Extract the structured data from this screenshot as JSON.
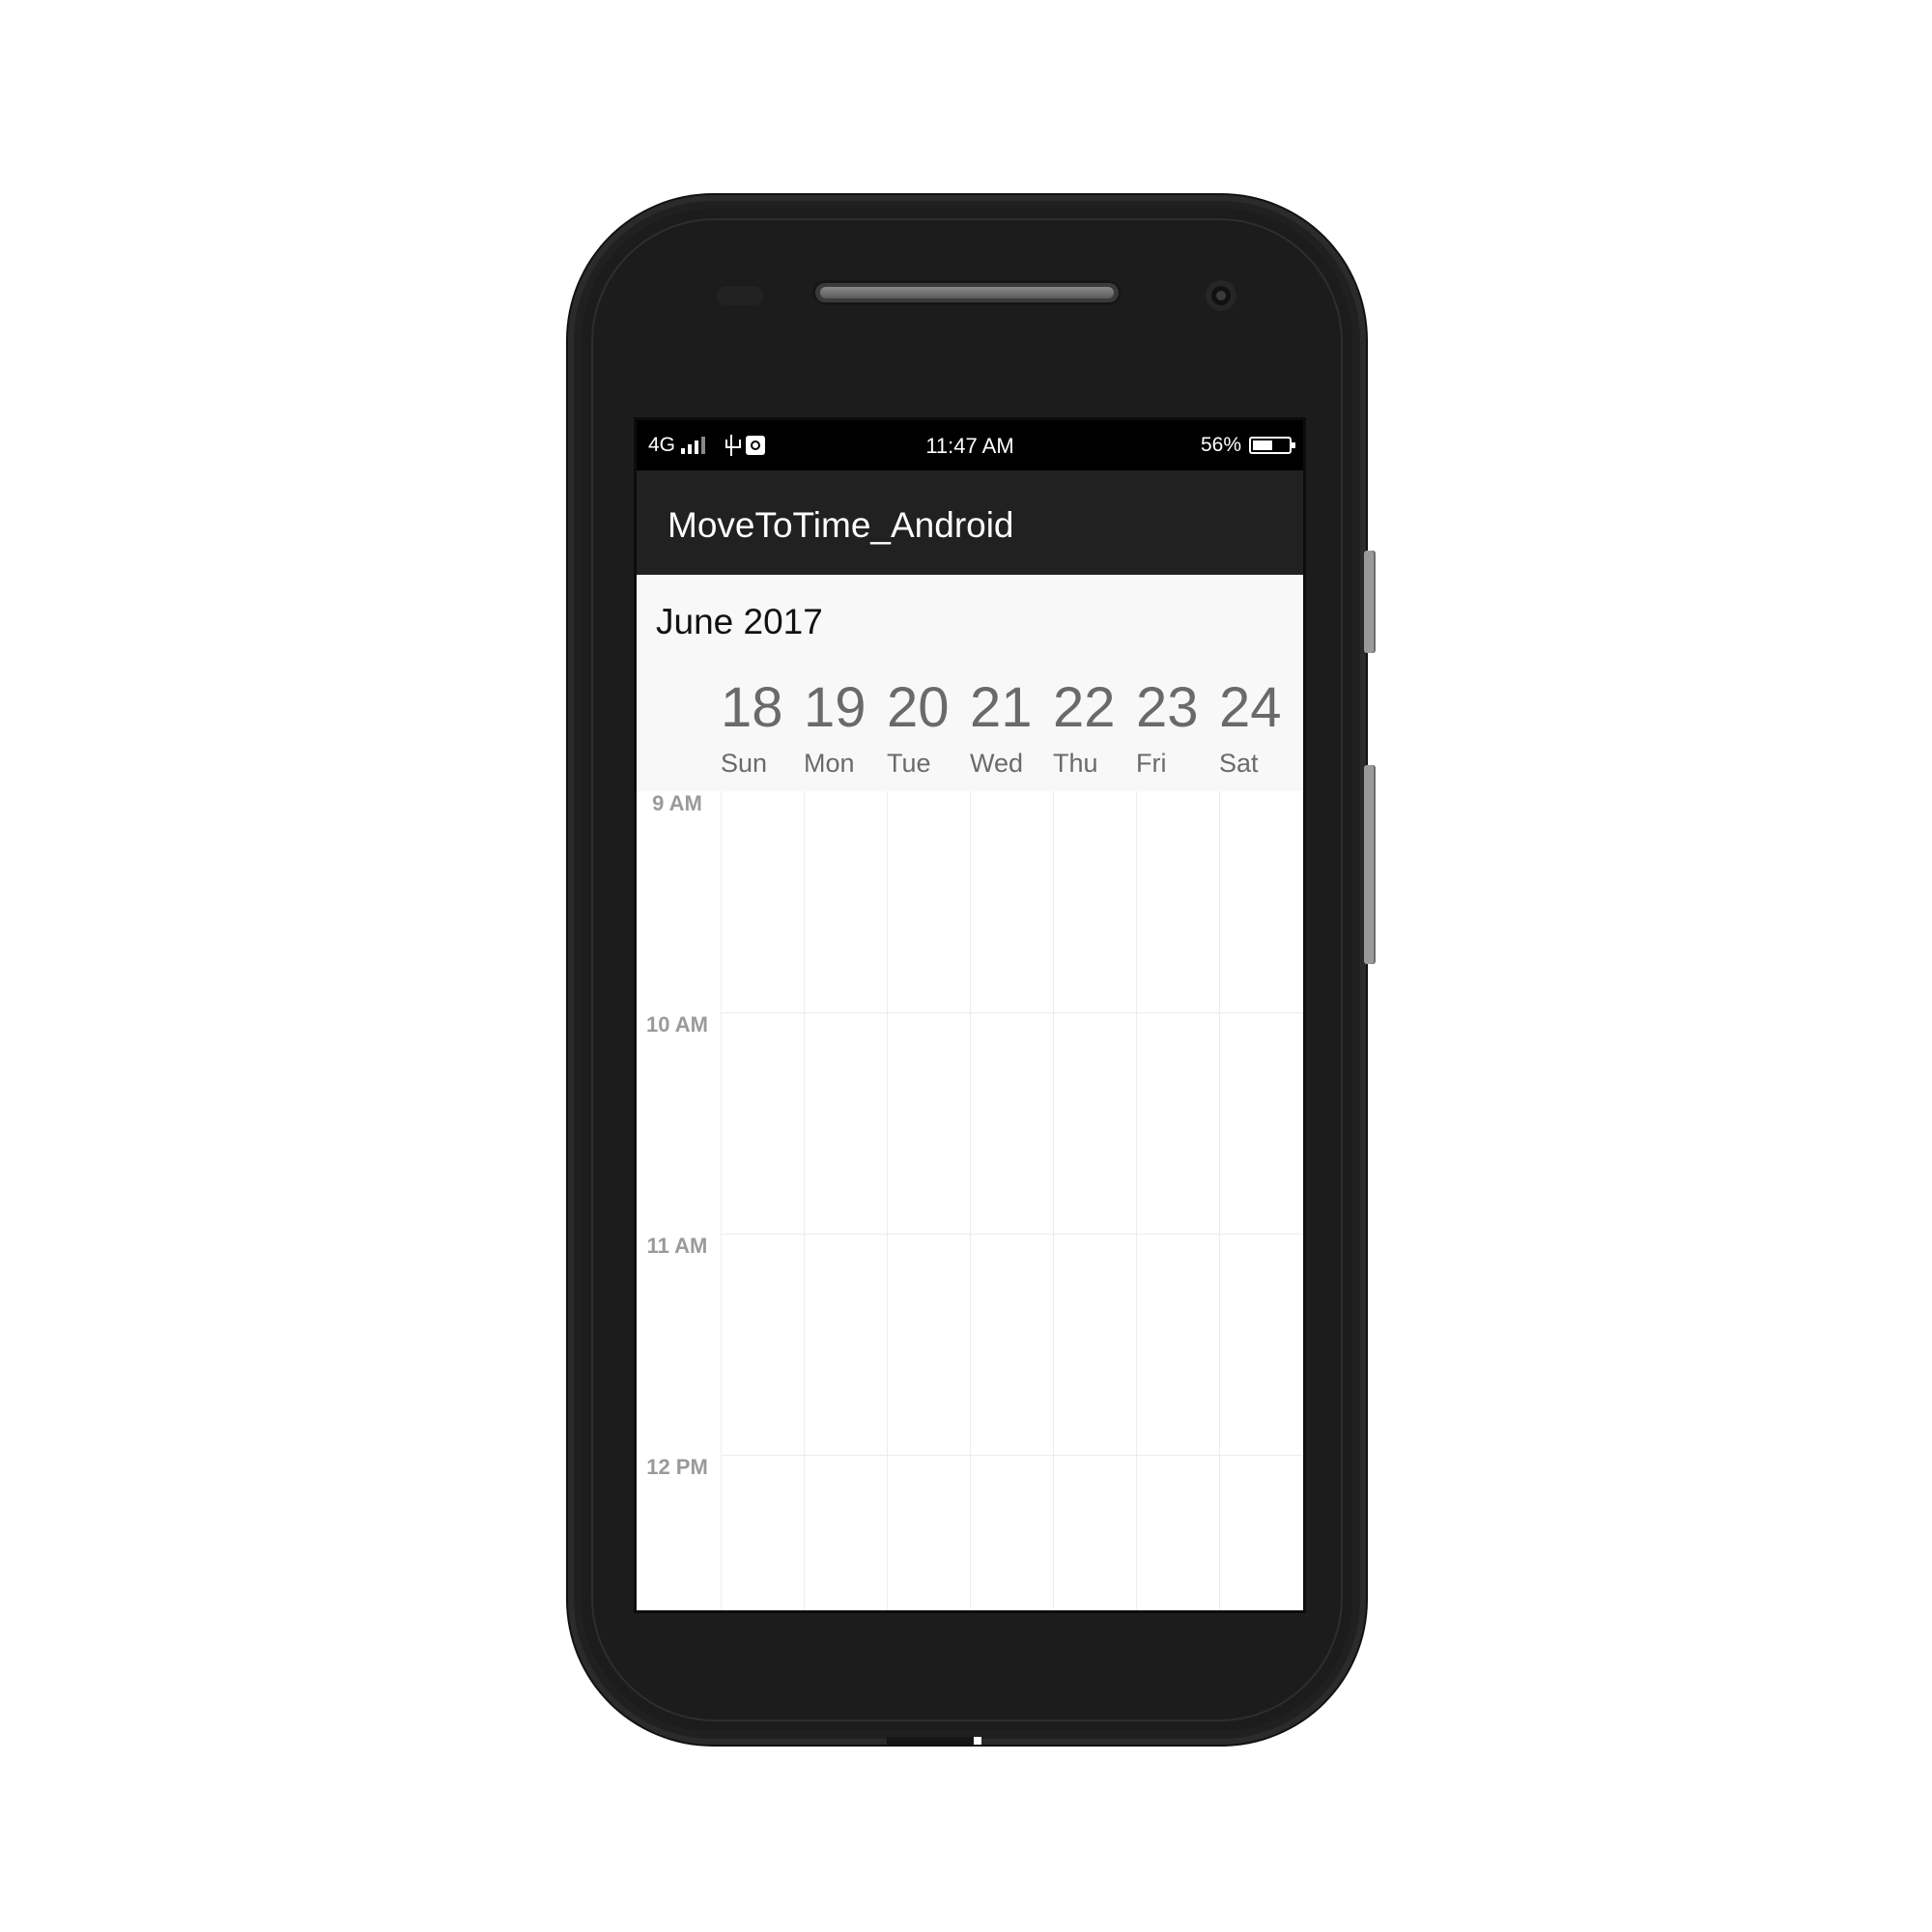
{
  "status_bar": {
    "network": "4G",
    "time": "11:47 AM",
    "battery_percent": "56%",
    "battery_level": 0.56
  },
  "app_bar": {
    "title": "MoveToTime_Android"
  },
  "calendar": {
    "month_title": "June 2017",
    "days": [
      {
        "num": "18",
        "name": "Sun"
      },
      {
        "num": "19",
        "name": "Mon"
      },
      {
        "num": "20",
        "name": "Tue"
      },
      {
        "num": "21",
        "name": "Wed"
      },
      {
        "num": "22",
        "name": "Thu"
      },
      {
        "num": "23",
        "name": "Fri"
      },
      {
        "num": "24",
        "name": "Sat"
      }
    ],
    "time_slots": [
      "9 AM",
      "10 AM",
      "11 AM",
      "12 PM"
    ]
  }
}
